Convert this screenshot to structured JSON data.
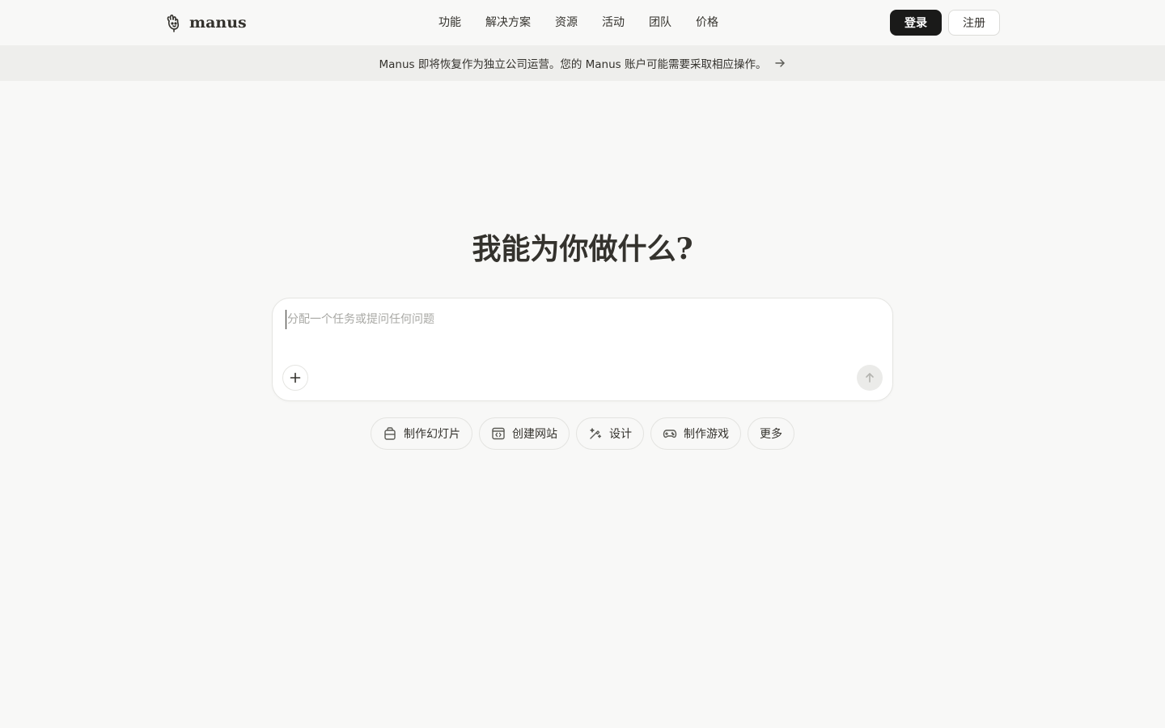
{
  "header": {
    "logo_text": "manus",
    "nav": [
      {
        "label": "功能"
      },
      {
        "label": "解决方案"
      },
      {
        "label": "资源"
      },
      {
        "label": "活动"
      },
      {
        "label": "团队"
      },
      {
        "label": "价格"
      }
    ],
    "login_label": "登录",
    "signup_label": "注册"
  },
  "banner": {
    "text": "Manus 即将恢复作为独立公司运营。您的 Manus 账户可能需要采取相应操作。"
  },
  "hero": {
    "title": "我能为你做什么?"
  },
  "composer": {
    "placeholder": "分配一个任务或提问任何问题",
    "value": ""
  },
  "chips": [
    {
      "label": "制作幻灯片",
      "icon": "slides-icon"
    },
    {
      "label": "创建网站",
      "icon": "website-icon"
    },
    {
      "label": "设计",
      "icon": "design-icon"
    },
    {
      "label": "制作游戏",
      "icon": "gamepad-icon"
    },
    {
      "label": "更多",
      "icon": ""
    }
  ],
  "colors": {
    "background": "#f8f8f7",
    "text": "#34322d",
    "primary_button": "#1a1a19",
    "banner": "#eeeeec"
  }
}
